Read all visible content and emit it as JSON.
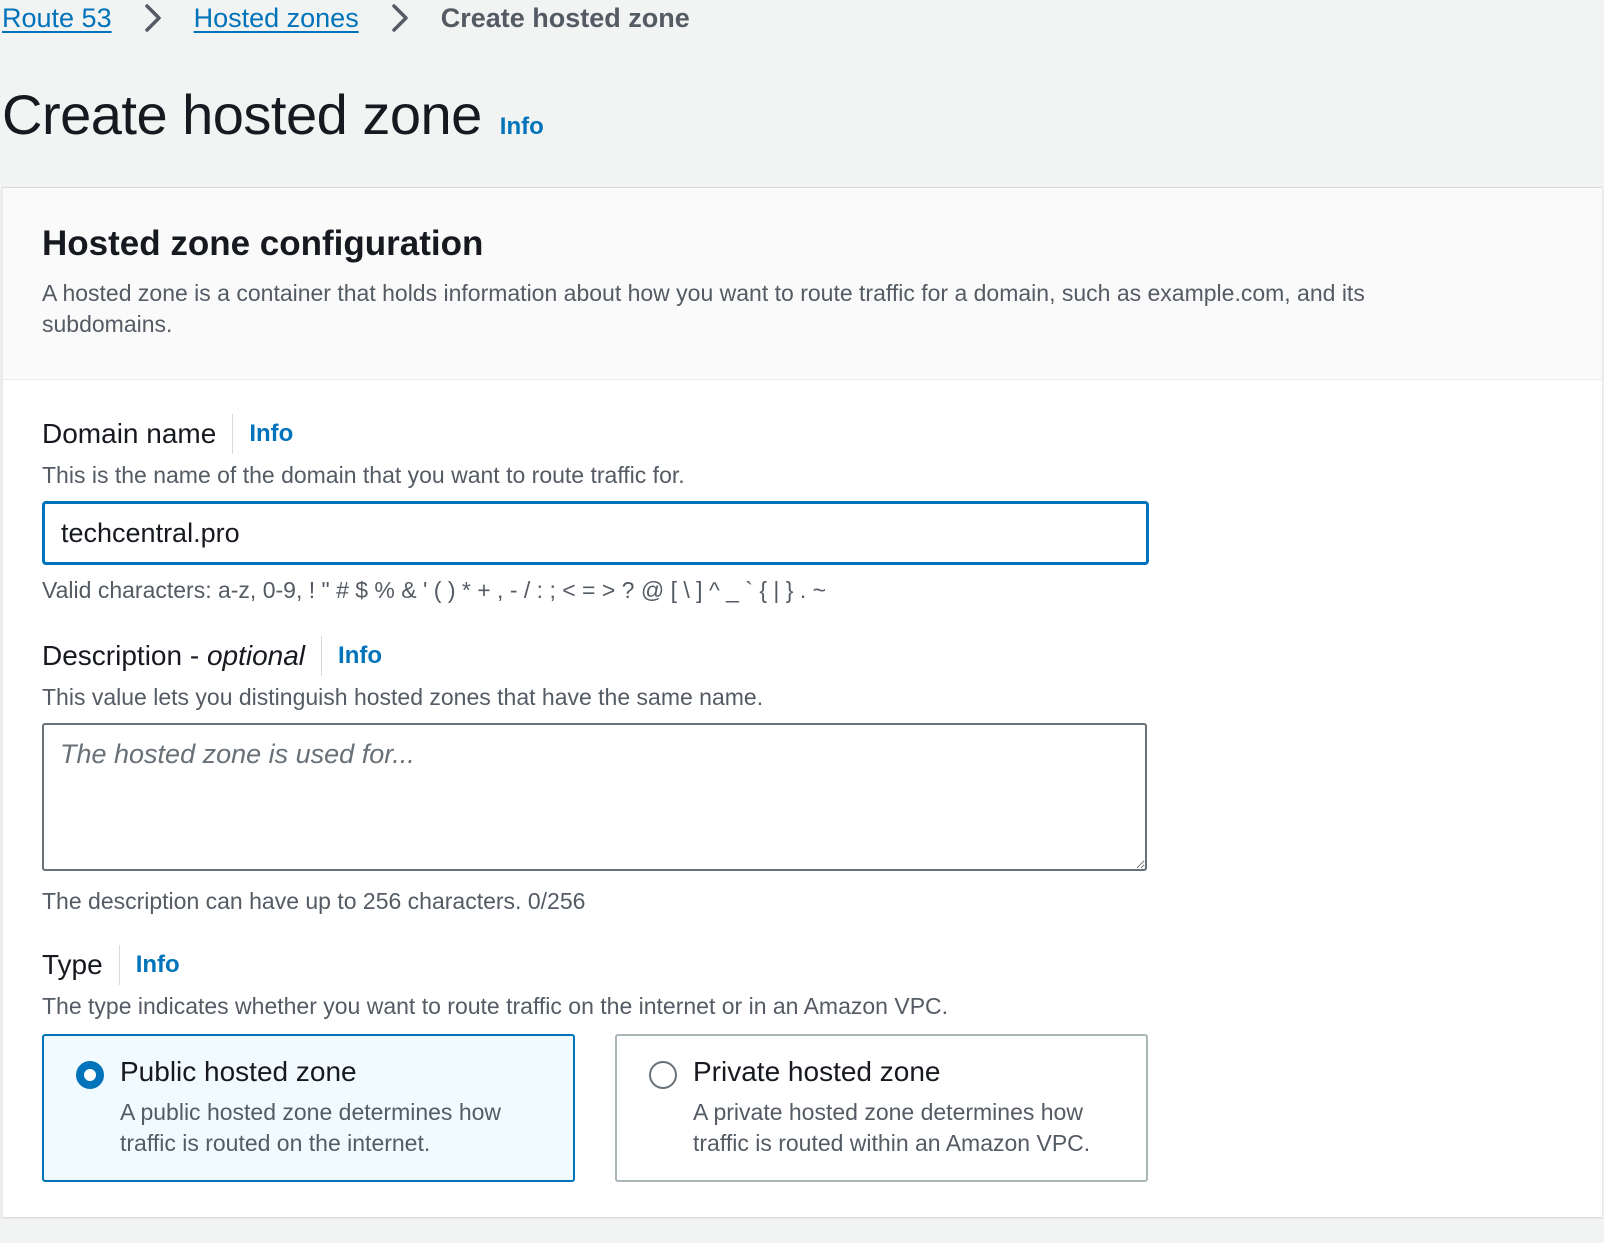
{
  "breadcrumb": {
    "items": [
      "Route 53",
      "Hosted zones"
    ],
    "current": "Create hosted zone"
  },
  "header": {
    "title": "Create hosted zone",
    "info": "Info"
  },
  "config": {
    "title": "Hosted zone configuration",
    "description": "A hosted zone is a container that holds information about how you want to route traffic for a domain, such as example.com, and its subdomains.",
    "domain": {
      "label": "Domain name",
      "info": "Info",
      "description": "This is the name of the domain that you want to route traffic for.",
      "value": "techcentral.pro",
      "constraint": "Valid characters: a-z, 0-9, ! \" # $ % & ' ( ) * + , - / : ; < = > ? @ [ \\ ] ^ _ ` { | } . ~"
    },
    "desc_field": {
      "label": "Description - ",
      "label_optional": "optional",
      "info": "Info",
      "description": "This value lets you distinguish hosted zones that have the same name.",
      "placeholder": "The hosted zone is used for...",
      "constraint": "The description can have up to 256 characters. 0/256"
    },
    "type": {
      "label": "Type",
      "info": "Info",
      "description": "The type indicates whether you want to route traffic on the internet or in an Amazon VPC.",
      "options": [
        {
          "title": "Public hosted zone",
          "description": "A public hosted zone determines how traffic is routed on the internet.",
          "selected": true
        },
        {
          "title": "Private hosted zone",
          "description": "A private hosted zone determines how traffic is routed within an Amazon VPC.",
          "selected": false
        }
      ]
    }
  },
  "colors": {
    "link": "#0073bb",
    "text": "#16191f",
    "muted": "#545b64",
    "background": "#f2f3f3"
  },
  "icons": {
    "breadcrumb_separator": "chevron-right-icon"
  }
}
